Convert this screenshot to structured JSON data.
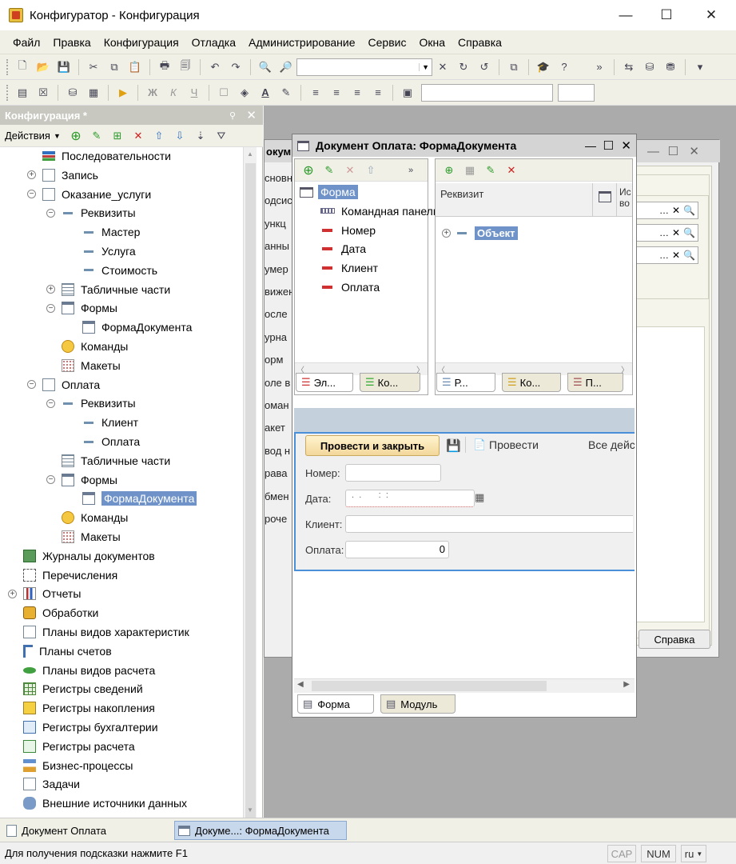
{
  "window": {
    "title": "Конфигуратор - Конфигурация",
    "minimize": "—",
    "maximize": "☐",
    "close": "✕"
  },
  "menu": [
    "Файл",
    "Правка",
    "Конфигурация",
    "Отладка",
    "Администрирование",
    "Сервис",
    "Окна",
    "Справка"
  ],
  "toolbar2": {
    "font_bold": "Ж",
    "font_italic": "К",
    "font_underline": "Ч",
    "text_color": "A"
  },
  "left_panel": {
    "title": "Конфигурация *",
    "actions_label": "Действия",
    "tree": [
      {
        "label": "Последовательности",
        "icon": "sequence-icon",
        "level": 1,
        "exp": ""
      },
      {
        "label": "Запись",
        "icon": "document-icon",
        "level": 1,
        "exp": "+"
      },
      {
        "label": "Оказание_услуги",
        "icon": "document-icon",
        "level": 1,
        "exp": "−"
      },
      {
        "label": "Реквизиты",
        "icon": "attribute-icon",
        "level": 2,
        "exp": "−"
      },
      {
        "label": "Мастер",
        "icon": "attribute-icon",
        "level": 3,
        "exp": ""
      },
      {
        "label": "Услуга",
        "icon": "attribute-icon",
        "level": 3,
        "exp": ""
      },
      {
        "label": "Стоимость",
        "icon": "attribute-icon",
        "level": 3,
        "exp": ""
      },
      {
        "label": "Табличные части",
        "icon": "table-icon",
        "level": 2,
        "exp": "+"
      },
      {
        "label": "Формы",
        "icon": "form-icon",
        "level": 2,
        "exp": "−"
      },
      {
        "label": "ФормаДокумента",
        "icon": "form-icon",
        "level": 3,
        "exp": ""
      },
      {
        "label": "Команды",
        "icon": "command-icon",
        "level": 2,
        "exp": ""
      },
      {
        "label": "Макеты",
        "icon": "template-icon",
        "level": 2,
        "exp": ""
      },
      {
        "label": "Оплата",
        "icon": "document-icon",
        "level": 1,
        "exp": "−"
      },
      {
        "label": "Реквизиты",
        "icon": "attribute-icon",
        "level": 2,
        "exp": "−"
      },
      {
        "label": "Клиент",
        "icon": "attribute-icon",
        "level": 3,
        "exp": ""
      },
      {
        "label": "Оплата",
        "icon": "attribute-icon",
        "level": 3,
        "exp": ""
      },
      {
        "label": "Табличные части",
        "icon": "table-icon",
        "level": 2,
        "exp": ""
      },
      {
        "label": "Формы",
        "icon": "form-icon",
        "level": 2,
        "exp": "−"
      },
      {
        "label": "ФормаДокумента",
        "icon": "form-icon",
        "level": 3,
        "exp": "",
        "selected": true
      },
      {
        "label": "Команды",
        "icon": "command-icon",
        "level": 2,
        "exp": ""
      },
      {
        "label": "Макеты",
        "icon": "template-icon",
        "level": 2,
        "exp": ""
      },
      {
        "label": "Журналы документов",
        "icon": "journal-icon",
        "level": 0,
        "exp": ""
      },
      {
        "label": "Перечисления",
        "icon": "enum-icon",
        "level": 0,
        "exp": ""
      },
      {
        "label": "Отчеты",
        "icon": "report-icon",
        "level": 0,
        "exp": "+"
      },
      {
        "label": "Обработки",
        "icon": "processing-icon",
        "level": 0,
        "exp": ""
      },
      {
        "label": "Планы видов характеристик",
        "icon": "chart-types-icon",
        "level": 0,
        "exp": ""
      },
      {
        "label": "Планы счетов",
        "icon": "accounts-icon",
        "level": 0,
        "exp": ""
      },
      {
        "label": "Планы видов расчета",
        "icon": "calc-types-icon",
        "level": 0,
        "exp": ""
      },
      {
        "label": "Регистры сведений",
        "icon": "info-register-icon",
        "level": 0,
        "exp": ""
      },
      {
        "label": "Регистры накопления",
        "icon": "accum-register-icon",
        "level": 0,
        "exp": ""
      },
      {
        "label": "Регистры бухгалтерии",
        "icon": "accounting-register-icon",
        "level": 0,
        "exp": ""
      },
      {
        "label": "Регистры расчета",
        "icon": "calc-register-icon",
        "level": 0,
        "exp": ""
      },
      {
        "label": "Бизнес-процессы",
        "icon": "business-process-icon",
        "level": 0,
        "exp": ""
      },
      {
        "label": "Задачи",
        "icon": "task-icon",
        "level": 0,
        "exp": ""
      },
      {
        "label": "Внешние источники данных",
        "icon": "external-source-icon",
        "level": 0,
        "exp": ""
      }
    ]
  },
  "back_window": {
    "title_partial": "окум",
    "list": [
      "сновн",
      "одсис",
      "ункц",
      "анны",
      "умер",
      "вижен",
      "осле",
      "урна",
      "орм",
      "оле в",
      "оман",
      "акет",
      "вод н",
      "рава",
      "бмен",
      "роче"
    ],
    "help_button": "Справка"
  },
  "form_window": {
    "title": "Документ Оплата: ФормаДокумента",
    "elements": [
      {
        "label": "Форма",
        "selected": true
      },
      {
        "label": "Командная панель"
      },
      {
        "label": "Номер"
      },
      {
        "label": "Дата"
      },
      {
        "label": "Клиент"
      },
      {
        "label": "Оплата"
      }
    ],
    "left_tabs": [
      "Эл...",
      "Ко..."
    ],
    "right_header": "Реквизит",
    "right_header2": "Ис\nво",
    "right_item": "Объект",
    "right_tabs": [
      "Р...",
      "Ко...",
      "П..."
    ],
    "preview": {
      "post_close": "Провести и закрыть",
      "post": "Провести",
      "all_actions": "Все дейс",
      "fields": [
        {
          "label": "Номер:",
          "value": ""
        },
        {
          "label": "Дата:",
          "value": " .  .       :  :"
        },
        {
          "label": "Клиент:",
          "value": ""
        },
        {
          "label": "Оплата:",
          "value": "0"
        }
      ]
    },
    "bottom_tabs": [
      "Форма",
      "Модуль"
    ]
  },
  "taskbar": [
    "Документ Оплата",
    "Докуме...: ФормаДокумента"
  ],
  "status": {
    "hint": "Для получения подсказки нажмите F1",
    "cap": "CAP",
    "num": "NUM",
    "lang": "ru"
  }
}
